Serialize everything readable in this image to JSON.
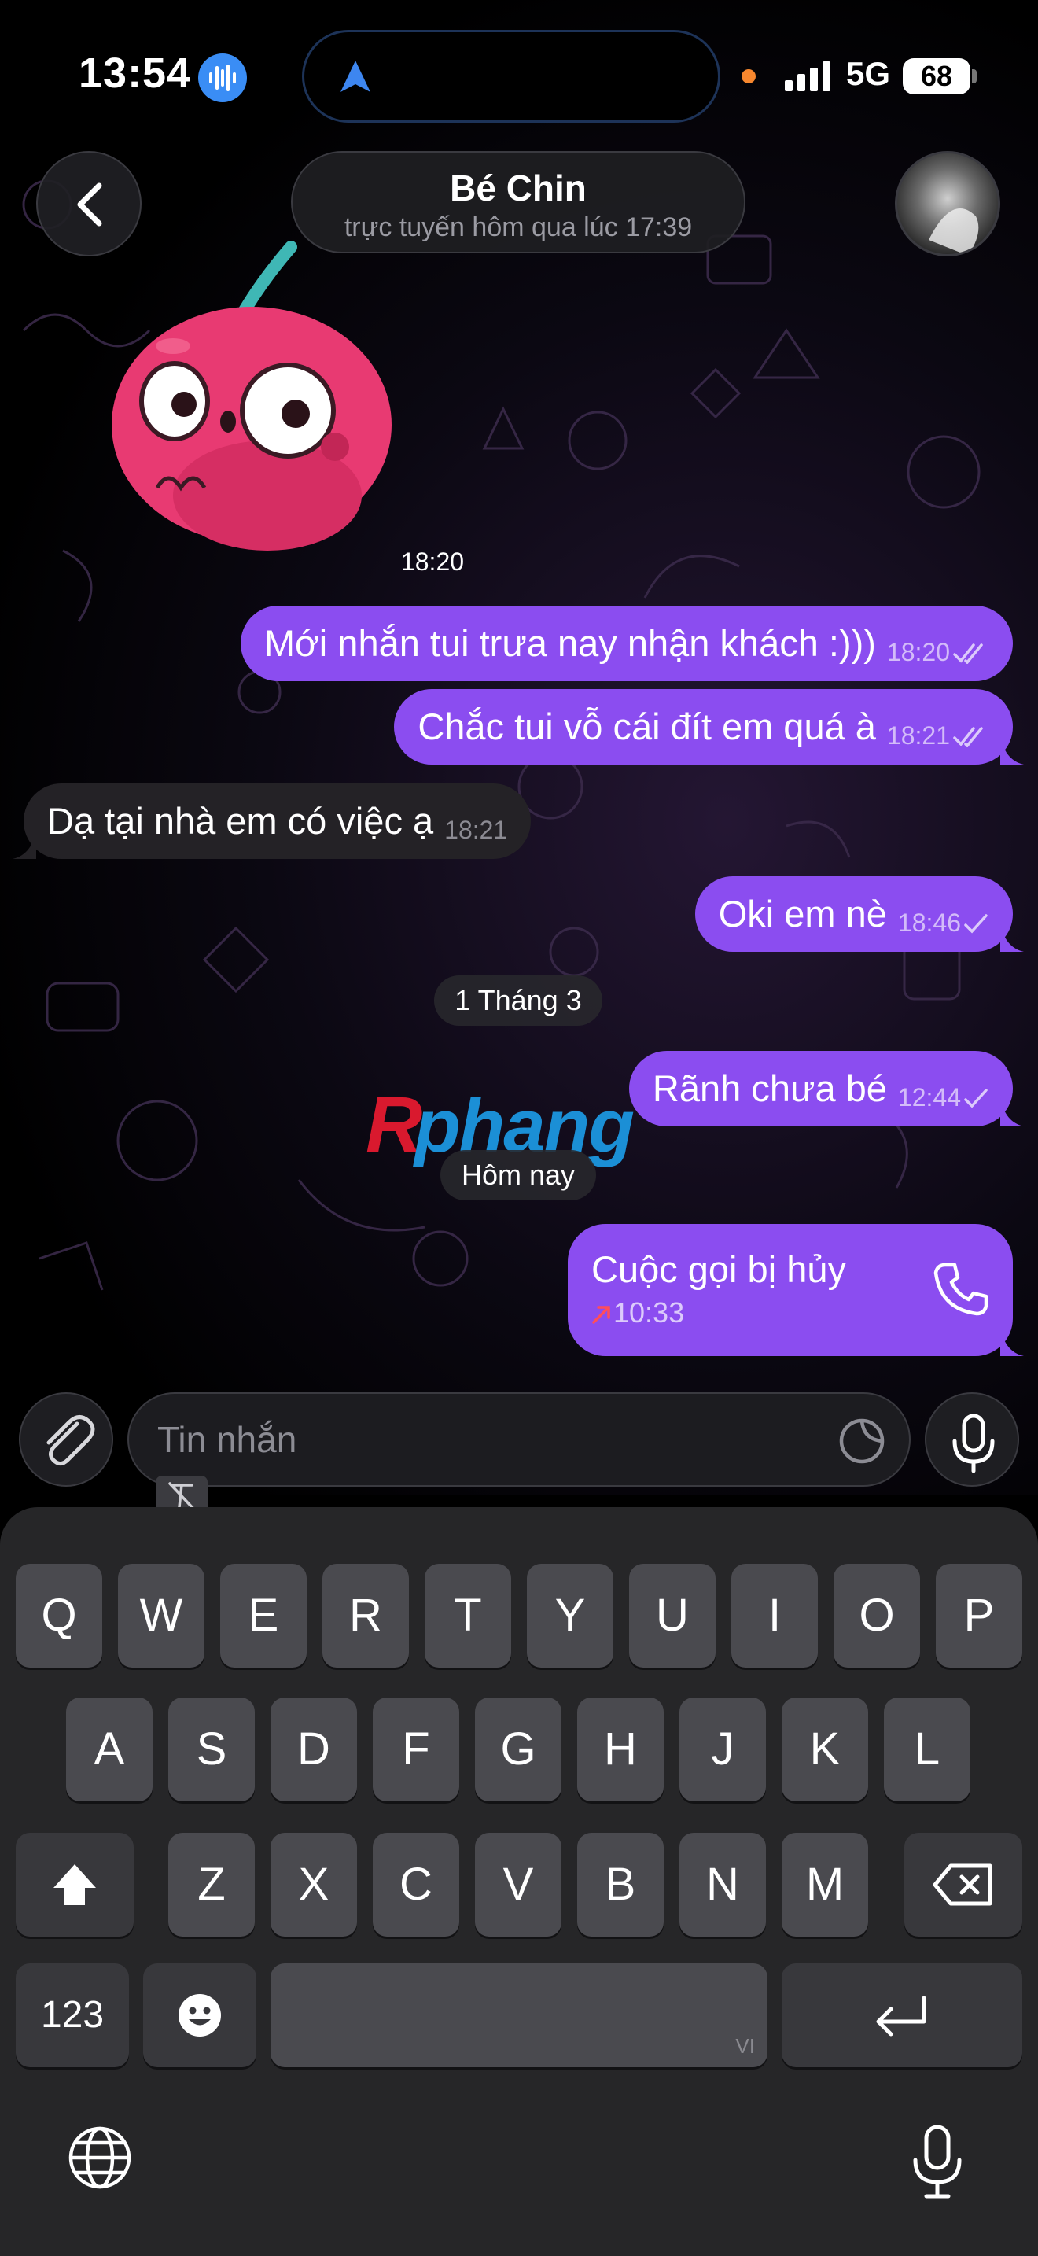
{
  "status_bar": {
    "time": "13:54",
    "network": "5G",
    "battery": "68"
  },
  "header": {
    "contact_name": "Bé Chin",
    "contact_status": "trực tuyến hôm qua lúc 17:39"
  },
  "messages": {
    "sticker_time": "18:20",
    "m1": {
      "text": "Mới nhắn tui trưa nay nhận khách :)))",
      "time": "18:20"
    },
    "m2": {
      "text": "Chắc tui vỗ cái đít em quá à",
      "time": "18:21"
    },
    "m3": {
      "text": "Dạ tại nhà em có việc ạ",
      "time": "18:21"
    },
    "m4": {
      "text": "Oki em nè",
      "time": "18:46"
    },
    "date1": "1 Tháng 3",
    "m5": {
      "text": "Rãnh chưa bé",
      "time": "12:44"
    },
    "date2": "Hôm nay",
    "call": {
      "title": "Cuộc gọi bị hủy",
      "time": "10:33"
    }
  },
  "watermark": "Rphang",
  "composer": {
    "placeholder": "Tin nhắn"
  },
  "keyboard": {
    "row1": [
      "Q",
      "W",
      "E",
      "R",
      "T",
      "Y",
      "U",
      "I",
      "O",
      "P"
    ],
    "row2": [
      "A",
      "S",
      "D",
      "F",
      "G",
      "H",
      "J",
      "K",
      "L"
    ],
    "row3": [
      "Z",
      "X",
      "C",
      "V",
      "B",
      "N",
      "M"
    ],
    "numbers_label": "123",
    "language_label": "VI"
  },
  "colors": {
    "outgoing_bubble": "#8b4df0",
    "incoming_bubble": "#242226",
    "keyboard_bg": "#262628"
  },
  "icons": [
    "back-chevron-icon",
    "siri-wave-icon",
    "navigation-arrow-icon",
    "signal-icon",
    "attach-icon",
    "sticker-icon",
    "mic-icon",
    "phone-icon",
    "shift-icon",
    "backspace-icon",
    "emoji-icon",
    "return-icon",
    "globe-icon",
    "dictation-icon",
    "read-check-icon",
    "outgoing-call-arrow-icon"
  ]
}
